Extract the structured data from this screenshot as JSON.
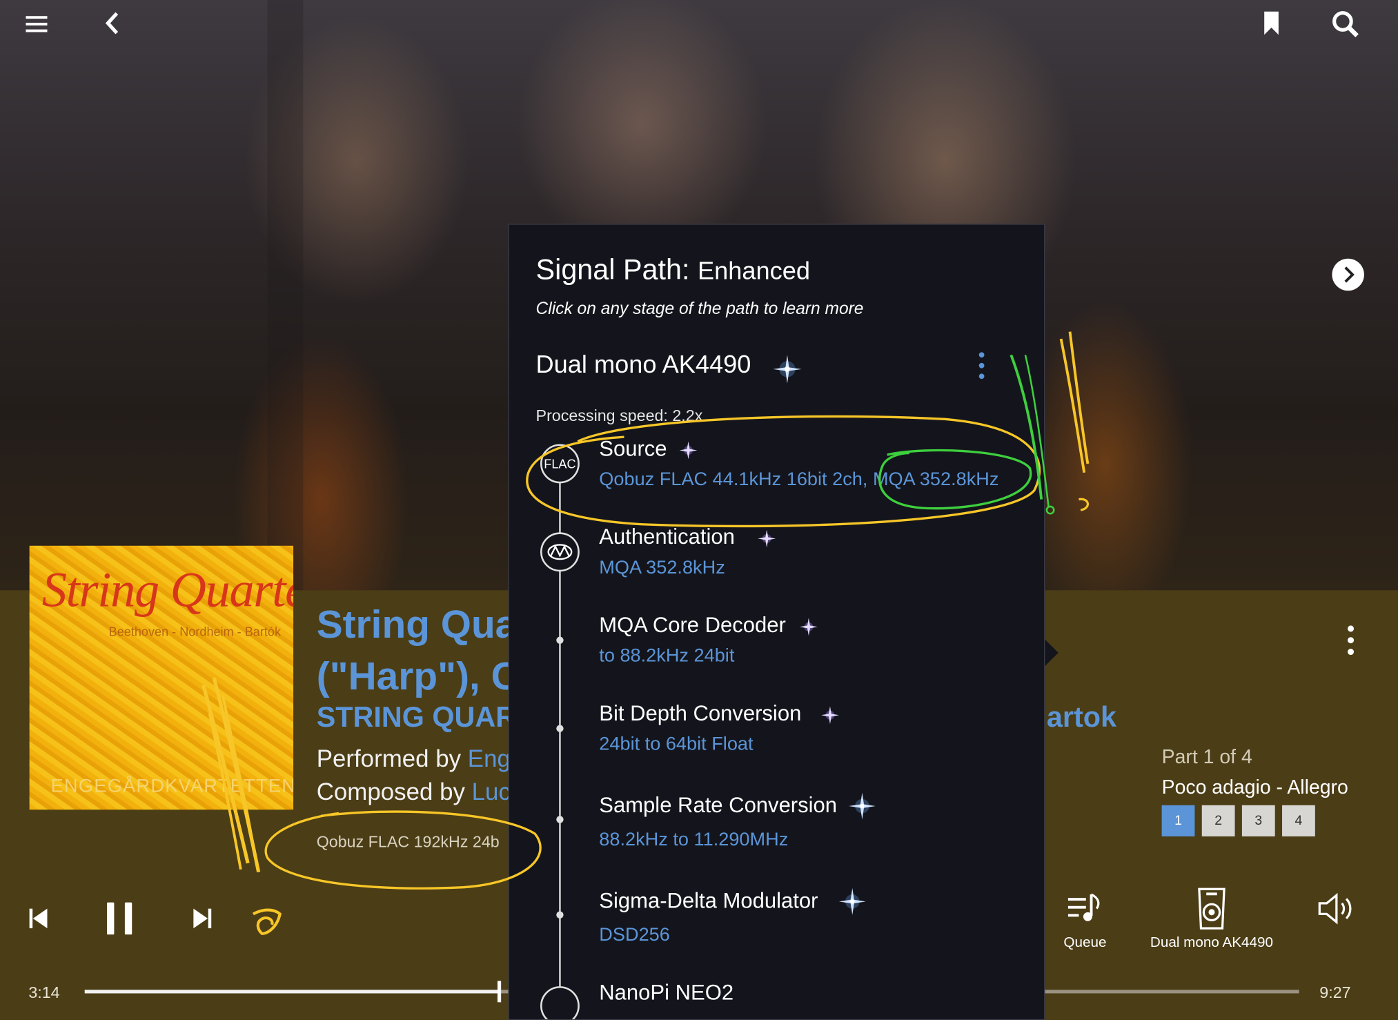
{
  "top_bar": {
    "menu_icon": "hamburger-icon",
    "back_icon": "chevron-left-icon",
    "bookmark_icon": "bookmark-icon",
    "search_icon": "search-icon",
    "next_image_icon": "chevron-right-circle-icon"
  },
  "album_art": {
    "title": "String Quartets",
    "composers": "Beethoven - Nordheim - Bartók",
    "ensemble": "ENGEGÅRDKVARTETTEN"
  },
  "now_playing": {
    "title_line1": "String Qua",
    "title_line2": "(\"Harp\"), C",
    "album": "STRING QUAR",
    "album_artist_tail": "artok",
    "performed_prefix": "Performed by ",
    "performed_link": "Eng",
    "composed_prefix": "Composed by ",
    "composed_link": "Luc",
    "format": "Qobuz FLAC 192kHz 24b"
  },
  "parts": {
    "label": "Part 1 of 4",
    "movement": "Poco adagio - Allegro",
    "buttons": [
      "1",
      "2",
      "3",
      "4"
    ],
    "active": "1"
  },
  "controls": {
    "queue_label": "Queue",
    "zone_label": "Dual mono AK4490",
    "elapsed": "3:14",
    "total": "9:27",
    "progress": 0.34
  },
  "signal_path": {
    "title": "Signal Path:",
    "quality": "Enhanced",
    "hint": "Click on any stage of the path to learn more",
    "device": "Dual mono AK4490",
    "speed": "Processing speed: 2.2x",
    "stages": [
      {
        "name": "Source",
        "node": "FLAC",
        "value": "Qobuz FLAC 44.1kHz 16bit 2ch, MQA 352.8kHz"
      },
      {
        "name": "Authentication",
        "node": "mqa-auth-icon",
        "value": "MQA 352.8kHz"
      },
      {
        "name": "MQA Core Decoder",
        "value": "to 88.2kHz 24bit"
      },
      {
        "name": "Bit Depth Conversion",
        "value": "24bit to 64bit Float"
      },
      {
        "name": "Sample Rate Conversion",
        "value": "88.2kHz to 11.290MHz"
      },
      {
        "name": "Sigma-Delta Modulator",
        "value": "DSD256"
      },
      {
        "name": "NanoPi NEO2",
        "value": ""
      }
    ]
  },
  "colors": {
    "accent_blue": "#5b95d8",
    "panel_bg": "#4b3d15",
    "popup_bg": "#14151c",
    "annotation_yellow": "#f7c628",
    "annotation_green": "#3ecf3e"
  }
}
